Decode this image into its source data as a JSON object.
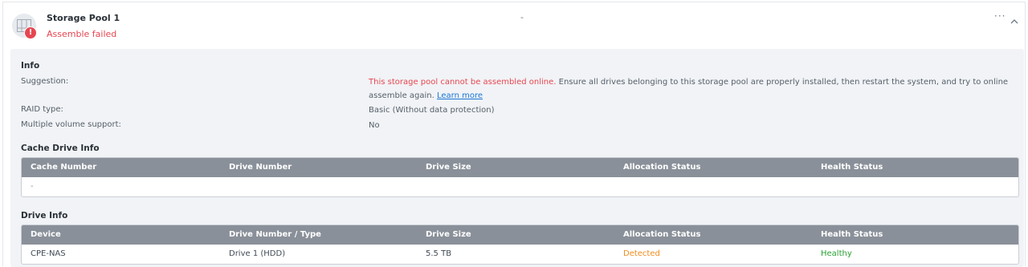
{
  "pool": {
    "title": "Storage Pool 1",
    "status": "Assemble failed",
    "middle_text": "-",
    "more_label": "···",
    "error_badge": "!"
  },
  "info": {
    "section_title": "Info",
    "suggestion_label": "Suggestion:",
    "suggestion_error": "This storage pool cannot be assembled online.",
    "suggestion_text": " Ensure all drives belonging to this storage pool are properly installed, then restart the system, and try to online assemble again. ",
    "learn_more": "Learn more",
    "raid_label": "RAID type:",
    "raid_value": "Basic (Without data protection)",
    "multi_label": "Multiple volume support:",
    "multi_value": "No"
  },
  "cache": {
    "section_title": "Cache Drive Info",
    "columns": [
      "Cache Number",
      "Drive Number",
      "Drive Size",
      "Allocation Status",
      "Health Status"
    ],
    "empty_text": "-"
  },
  "drives": {
    "section_title": "Drive Info",
    "columns": [
      "Device",
      "Drive Number / Type",
      "Drive Size",
      "Allocation Status",
      "Health Status"
    ],
    "rows": [
      {
        "device": "CPE-NAS",
        "drive": "Drive 1 (HDD)",
        "size": "5.5 TB",
        "allocation": "Detected",
        "health": "Healthy"
      }
    ]
  },
  "colors": {
    "error": "#e64650",
    "link": "#1b76d6",
    "warning": "#f08c1e",
    "success": "#2aa233",
    "table_header": "#8a9099"
  }
}
